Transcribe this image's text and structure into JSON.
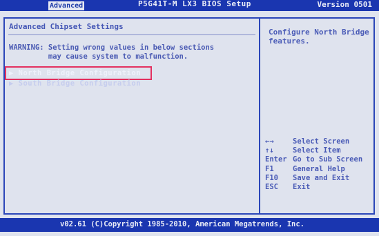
{
  "header": {
    "active_tab": "Advanced",
    "title": "P5G41T-M LX3 BIOS Setup",
    "version": "Version 0501"
  },
  "main": {
    "section_title": "Advanced Chipset Settings",
    "warning": "WARNING: Setting wrong values in below sections\n         may cause system to malfunction.",
    "items": [
      {
        "label": "North Bridge Configuration"
      },
      {
        "label": "South Bridge Configuration"
      }
    ]
  },
  "help": {
    "text": "Configure North Bridge features."
  },
  "keys": [
    {
      "key": "←→",
      "action": "Select Screen"
    },
    {
      "key": "↑↓",
      "action": "Select Item"
    },
    {
      "key": "Enter",
      "action": "Go to Sub Screen"
    },
    {
      "key": "F1",
      "action": "General Help"
    },
    {
      "key": "F10",
      "action": "Save and Exit"
    },
    {
      "key": "ESC",
      "action": "Exit"
    }
  ],
  "footer": {
    "copyright": "v02.61 (C)Copyright 1985-2010, American Megatrends, Inc."
  },
  "colors": {
    "bar_blue": "#1a36b0",
    "text_blue": "#4a5bb6",
    "highlight_red": "#e3305f",
    "background": "#dfe3ee"
  }
}
